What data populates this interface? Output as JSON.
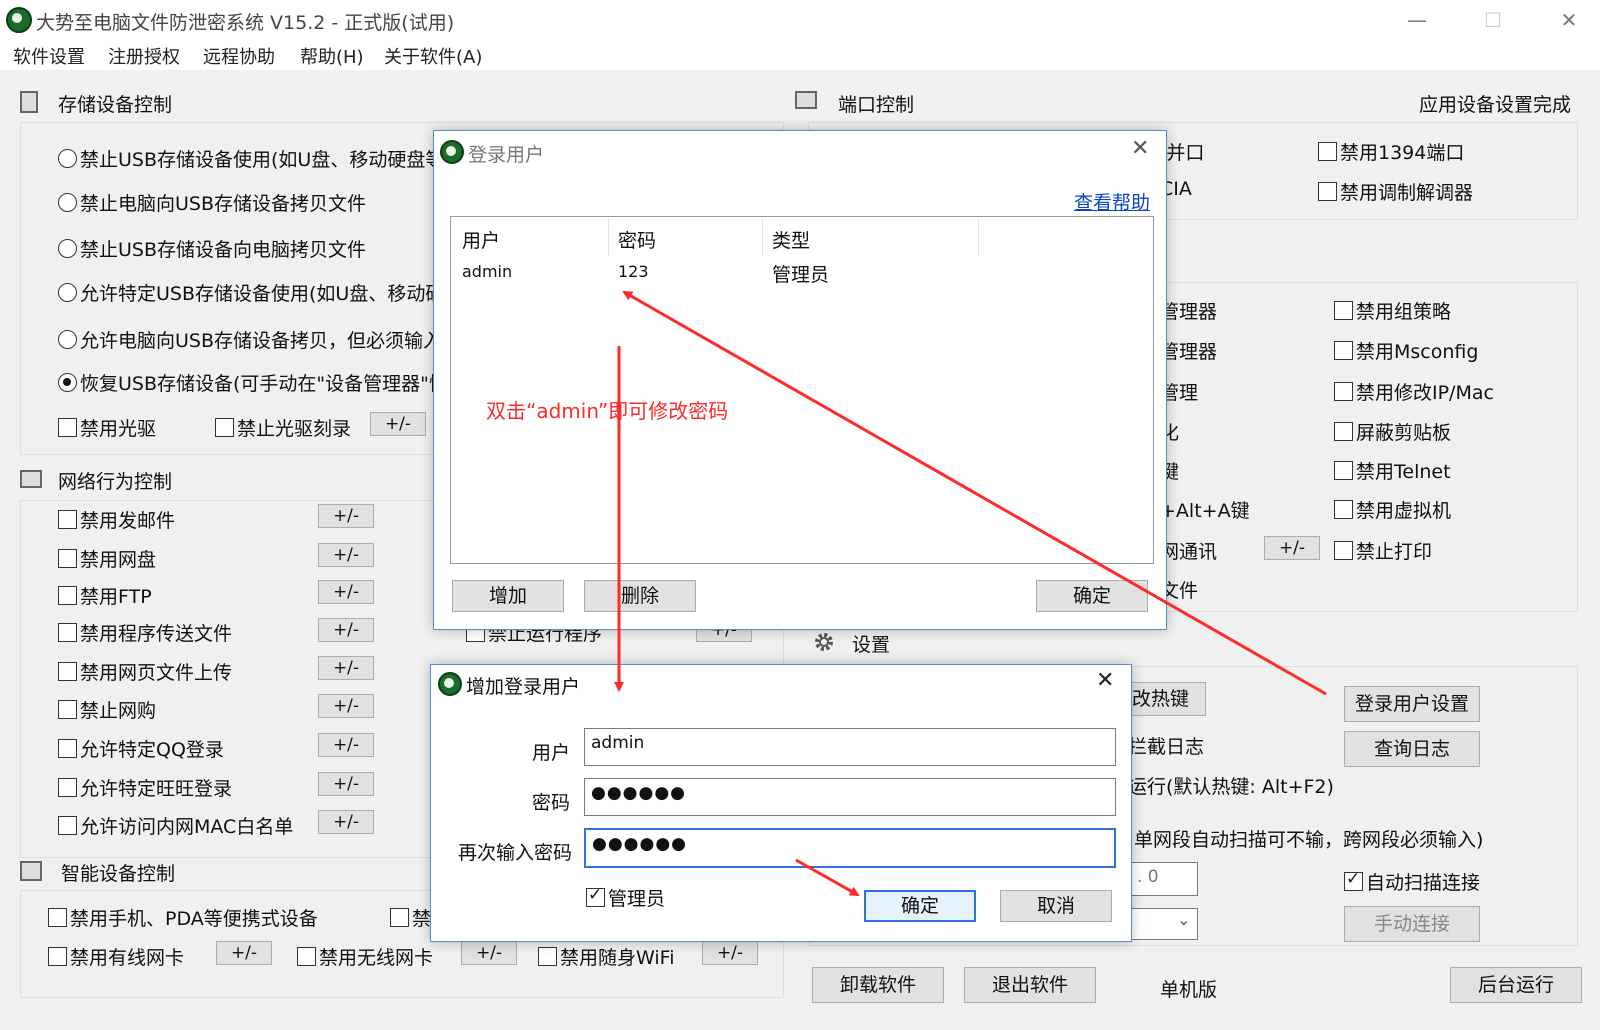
{
  "window": {
    "title": "大势至电脑文件防泄密系统 V15.2 - 正式版(试用)",
    "minimize_glyph": "—",
    "maximize_glyph": "☐",
    "close_glyph": "✕"
  },
  "menu": [
    "软件设置",
    "注册授权",
    "远程协助",
    "帮助(H)",
    "关于软件(A)"
  ],
  "storage": {
    "title": "存储设备控制",
    "options": [
      "禁止USB存储设备使用(如U盘、移动硬盘等",
      "禁止电脑向USB存储设备拷贝文件",
      "禁止USB存储设备向电脑拷贝文件",
      "允许特定USB存储设备使用(如U盘、移动硬",
      "允许电脑向USB存储设备拷贝，但必须输入",
      "恢复USB存储设备(可手动在\"设备管理器\"恢"
    ],
    "selected_index": 5,
    "cdrom": "禁用光驱",
    "cd_burn": "禁止光驱刻录",
    "pm_label": "+/-"
  },
  "port": {
    "title": "端口控制",
    "status": "应用设备设置完成",
    "partial_left": [
      "/并口",
      "CIA"
    ],
    "items": [
      "禁用1394端口",
      "禁用调制解调器"
    ]
  },
  "system": {
    "partial_left": [
      "管理器",
      "管理器",
      "管理",
      "化",
      "键",
      "+Alt+A键",
      "网通讯",
      "文件"
    ],
    "items": [
      "禁用组策略",
      "禁用Msconfig",
      "禁用修改IP/Mac",
      "屏蔽剪贴板",
      "禁用Telnet",
      "禁用虚拟机",
      "禁止打印"
    ],
    "pm_label": "+/-"
  },
  "network": {
    "title": "网络行为控制",
    "items": [
      "禁用发邮件",
      "禁用网盘",
      "禁用FTP",
      "禁用程序传送文件",
      "禁用网页文件上传",
      "禁止网购",
      "允许特定QQ登录",
      "允许特定旺旺登录",
      "允许访问内网MAC白名单"
    ],
    "pm_label": "+/-",
    "run_program": "禁止运行程序"
  },
  "smart": {
    "title": "智能设备控制",
    "phone": "禁用手机、PDA等便携式设备",
    "partial": "禁",
    "wired": "禁用有线网卡",
    "wireless": "禁用无线网卡",
    "wifi": "禁用随身WiFi",
    "pm_label": "+/-"
  },
  "settings": {
    "title": "设置",
    "hotkey_partial": "改热键",
    "log_partial": "拦截日志",
    "run_partial": "运行(默认热键: Alt+F2)",
    "scan_partial": "单网段自动扫描可不输，跨网段必须输入)",
    "ip_partial": ".    0",
    "login_user_btn": "登录用户设置",
    "query_log_btn": "查询日志",
    "auto_connect": "自动扫描连接",
    "manual_connect": "手动连接"
  },
  "bottom": {
    "uninstall": "卸载软件",
    "exit": "退出软件",
    "edition": "单机版",
    "background": "后台运行"
  },
  "login_dialog": {
    "title": "登录用户",
    "help_link": "查看帮助",
    "columns": [
      "用户",
      "密码",
      "类型"
    ],
    "rows": [
      [
        "admin",
        "123",
        "管理员"
      ]
    ],
    "add": "增加",
    "delete": "删除",
    "ok": "确定"
  },
  "annotation": {
    "text": "双击“admin”即可修改密码",
    "color": "#ff2a2a"
  },
  "add_dialog": {
    "title": "增加登录用户",
    "user_label": "用户",
    "user_value": "admin",
    "pwd_label": "密码",
    "pwd_value": "●●●●●●",
    "pwd2_label": "再次输入密码",
    "pwd2_value": "●●●●●●",
    "admin_label": "管理员",
    "ok": "确定",
    "cancel": "取消"
  }
}
